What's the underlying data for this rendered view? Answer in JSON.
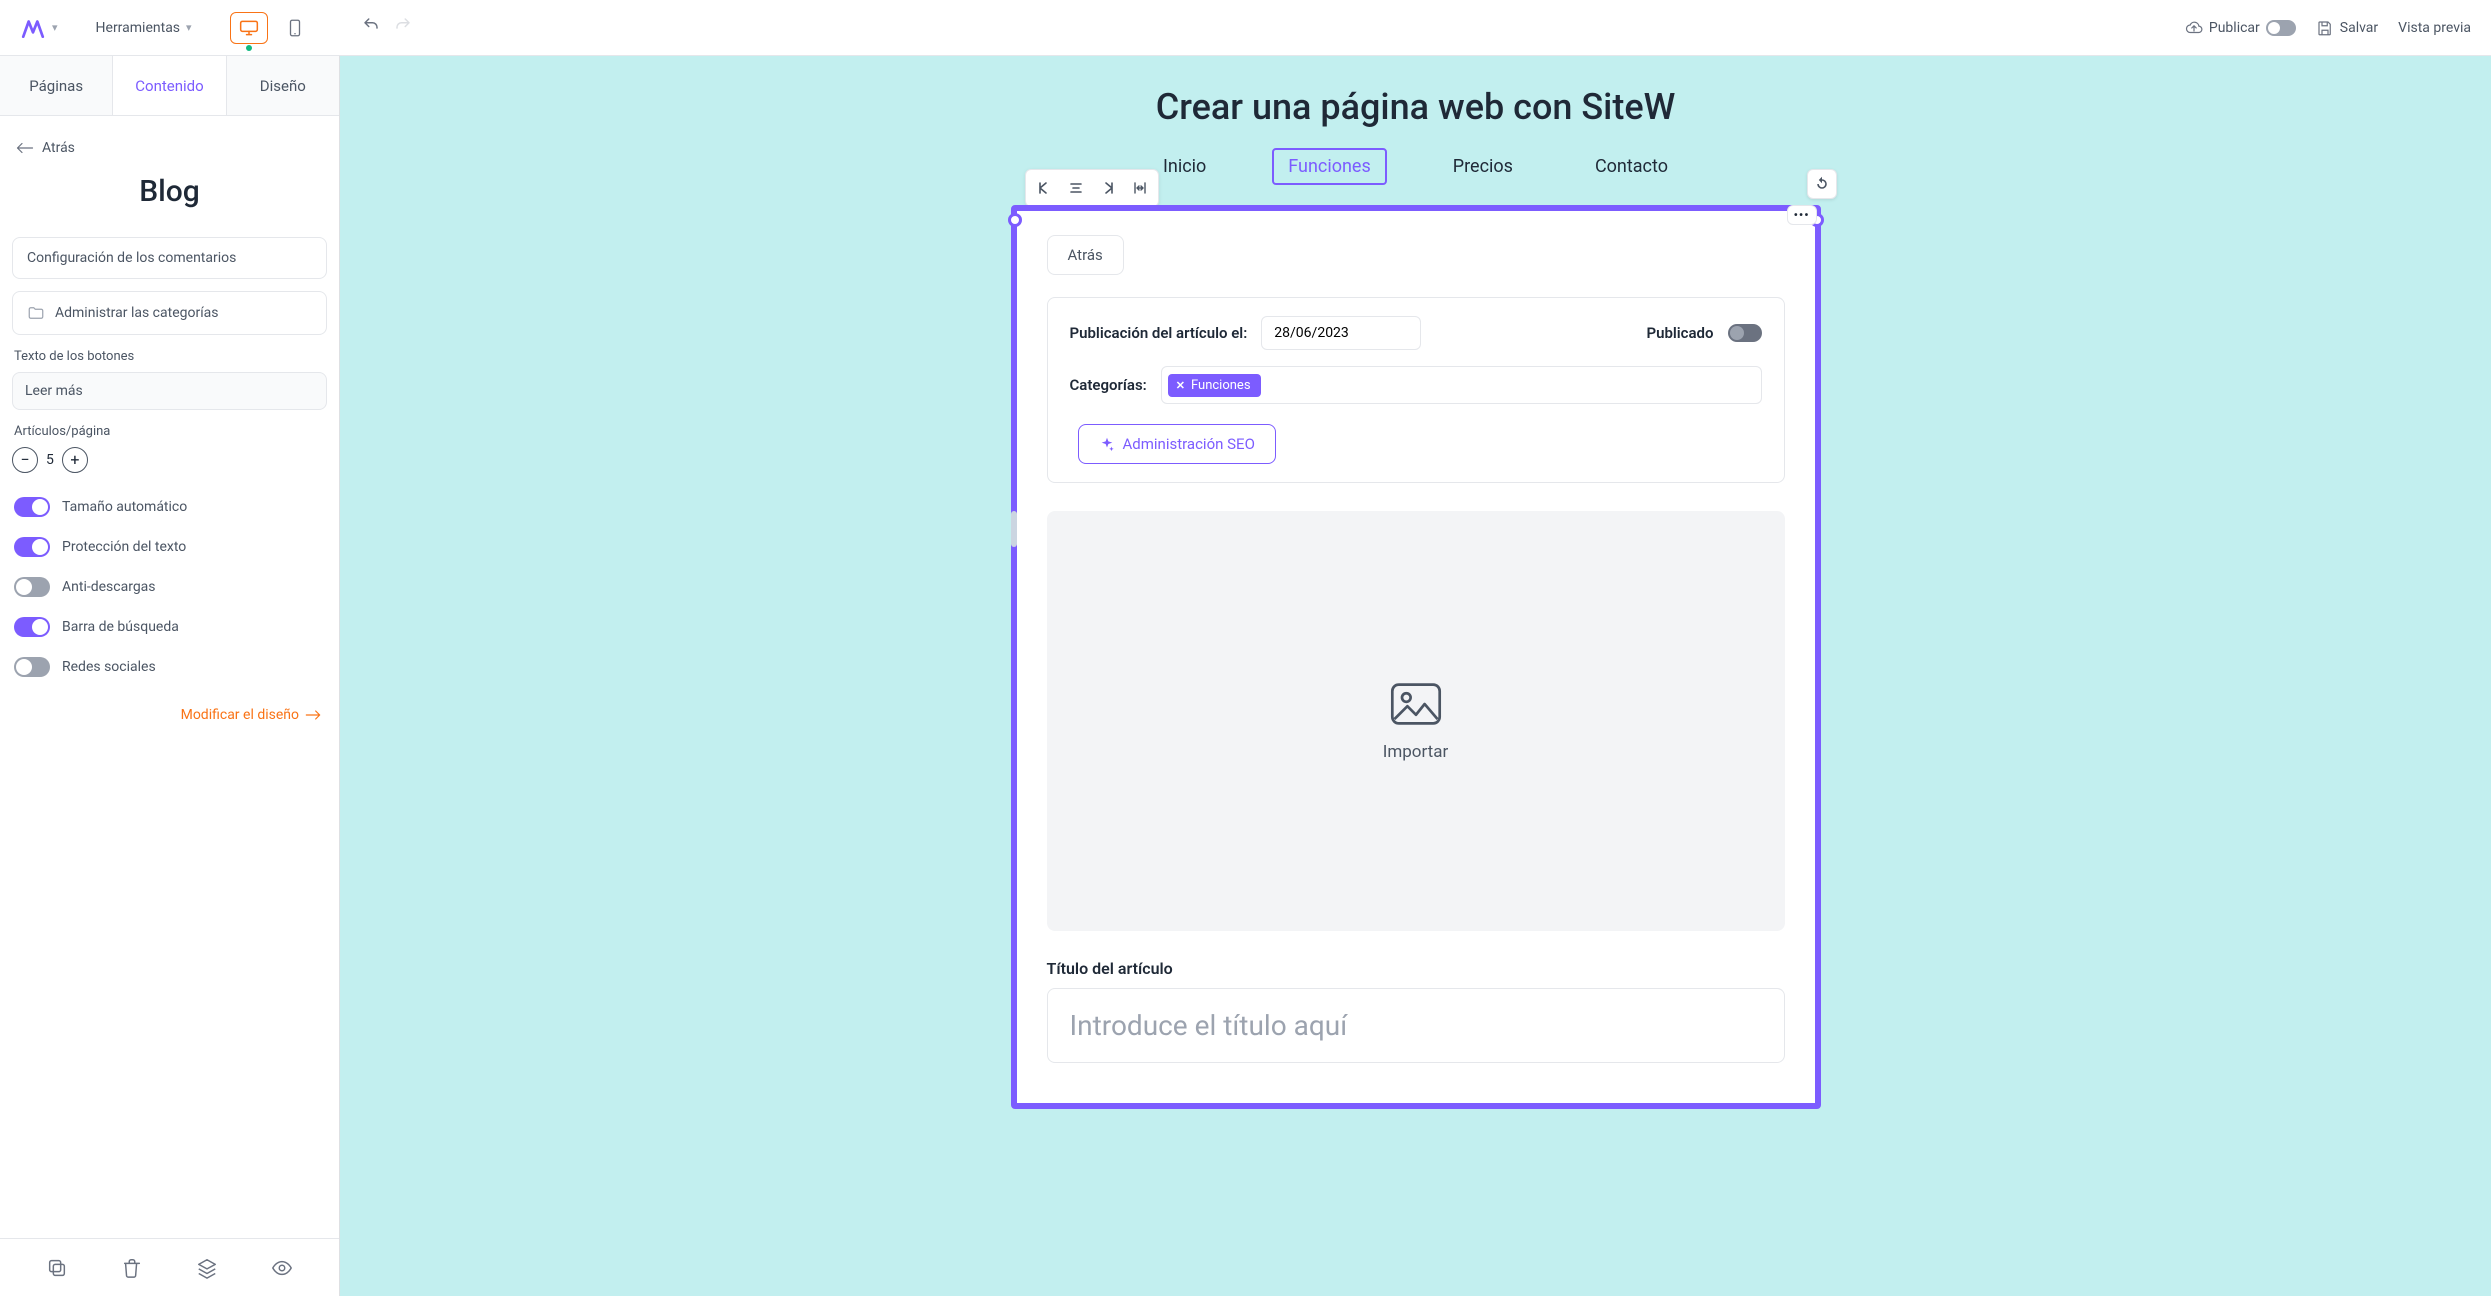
{
  "topbar": {
    "tools_label": "Herramientas",
    "publish_label": "Publicar",
    "save_label": "Salvar",
    "preview_label": "Vista previa"
  },
  "sidebar": {
    "tabs": {
      "pages": "Páginas",
      "content": "Contenido",
      "design": "Diseño"
    },
    "back_label": "Atrás",
    "title": "Blog",
    "comments_config": "Configuración de los comentarios",
    "manage_categories": "Administrar las categorías",
    "button_text_label": "Texto de los botones",
    "button_text_value": "Leer más",
    "articles_per_page_label": "Artículos/página",
    "articles_per_page_value": "5",
    "toggles": {
      "auto_size": "Tamaño automático",
      "text_protection": "Protección del texto",
      "anti_download": "Anti-descargas",
      "search_bar": "Barra de búsqueda",
      "social": "Redes sociales"
    },
    "modify_design": "Modificar el diseño"
  },
  "site": {
    "title": "Crear una página web con SiteW",
    "nav": {
      "home": "Inicio",
      "features": "Funciones",
      "pricing": "Precios",
      "contact": "Contacto"
    }
  },
  "block": {
    "back": "Atrás",
    "publication_label": "Publicación del artículo el:",
    "publication_date": "28/06/2023",
    "published_label": "Publicado",
    "categories_label": "Categorías:",
    "category_tag": "Funciones",
    "seo_label": "Administración SEO",
    "import_label": "Importar",
    "article_title_label": "Título del artículo",
    "article_title_placeholder": "Introduce el título aquí"
  }
}
